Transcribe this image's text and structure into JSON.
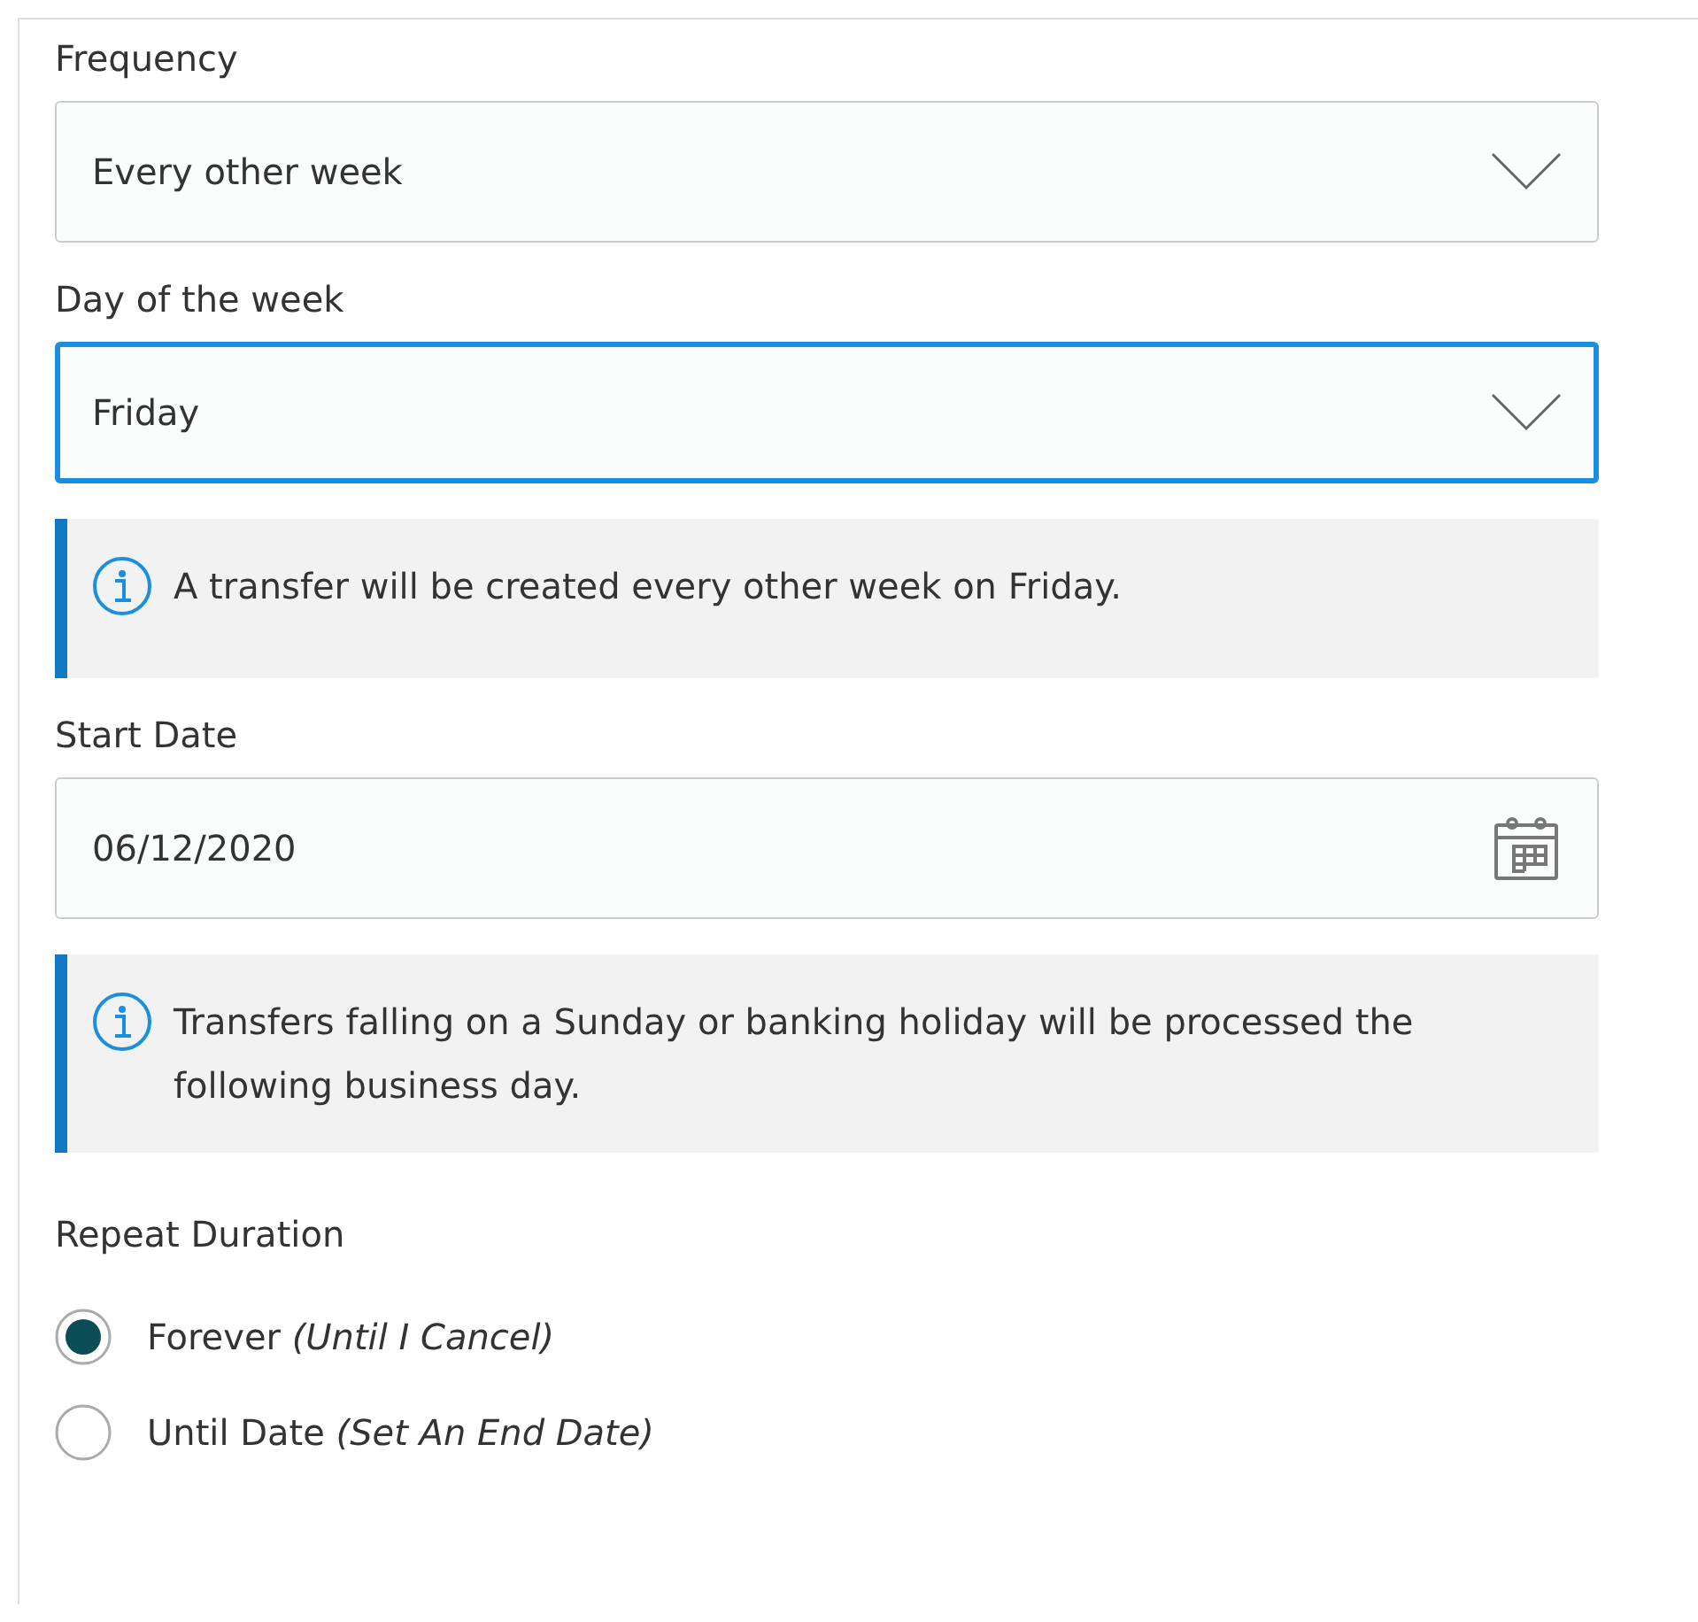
{
  "fields": [
    {
      "kind": "select",
      "label": "Frequency",
      "value": "Every other week",
      "focused": false
    },
    {
      "kind": "select",
      "label": "Day of the week",
      "value": "Friday",
      "focused": true
    },
    {
      "kind": "note",
      "text": "A transfer will be created every other week on Friday."
    },
    {
      "kind": "date",
      "label": "Start Date",
      "value": "06/12/2020",
      "focused": false
    },
    {
      "kind": "note",
      "text": "Transfers falling on a Sunday or banking holiday will be processed the following business day."
    }
  ],
  "repeat_duration": {
    "label": "Repeat Duration",
    "options": [
      {
        "label": "Forever *(Until I Cancel)*",
        "selected": true
      },
      {
        "label": "Until Date *(Set An End Date)*",
        "selected": false
      }
    ]
  }
}
